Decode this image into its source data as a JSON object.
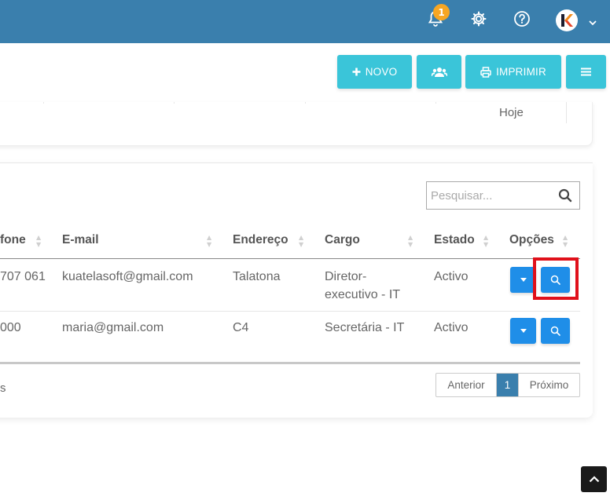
{
  "topbar": {
    "notification_count": "1",
    "avatar_letter": "K",
    "colors": {
      "bar": "#3a7fad",
      "badge": "#f6a623"
    }
  },
  "toolbar": {
    "novo_label": "NOVO",
    "imprimir_label": "IMPRIMIR"
  },
  "summary": {
    "date_label": "Hoje"
  },
  "search": {
    "placeholder": "Pesquisar..."
  },
  "table": {
    "columns": [
      "fone",
      "E-mail",
      "Endereço",
      "Cargo",
      "Estado",
      "Opções"
    ],
    "rows": [
      {
        "phone": "707 061",
        "email": "kuatelasoft@gmail.com",
        "address": "Talatona",
        "role_line1": "Diretor-",
        "role_line2": "executivo - IT",
        "status": "Activo"
      },
      {
        "phone": "000",
        "email": "maria@gmail.com",
        "address": "C4",
        "role_line1": "Secretária - IT",
        "role_line2": "",
        "status": "Activo"
      }
    ]
  },
  "footer": {
    "info_fragment": "s",
    "pagination": {
      "prev": "Anterior",
      "current": "1",
      "next": "Próximo"
    }
  }
}
